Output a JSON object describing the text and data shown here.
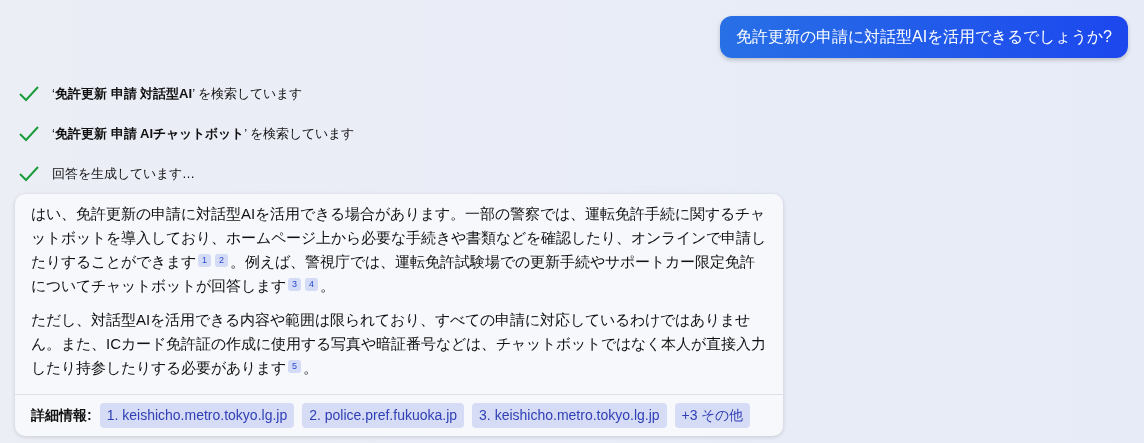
{
  "user_message": "免許更新の申請に対話型AIを活用できるでしょうか?",
  "progress": [
    {
      "text": "‘**免許更新 申請 対話型AI**’ を検索しています",
      "done": true
    },
    {
      "text": "‘**免許更新 申請 AIチャットボット**’ を検索しています",
      "done": true
    },
    {
      "text": "回答を生成しています…",
      "done": true
    }
  ],
  "answer": {
    "paragraphs": [
      [
        {
          "kind": "text",
          "text": "はい、免許更新の申請に対話型AIを活用できる場合があります。一部の警察では、運転免許手続に関するチャットボットを導入しており、ホームページ上から必要な手続きや書類などを確認したり、オンラインで申請したりすることができます"
        },
        {
          "kind": "cite",
          "text": "1"
        },
        {
          "kind": "cite",
          "text": "2"
        },
        {
          "kind": "text",
          "text": "。例えば、警視庁では、運転免許試験場での更新手続やサポートカー限定免許についてチャットボットが回答します"
        },
        {
          "kind": "cite",
          "text": "3"
        },
        {
          "kind": "cite",
          "text": "4"
        },
        {
          "kind": "text",
          "text": "。"
        }
      ],
      [
        {
          "kind": "text",
          "text": "ただし、対話型AIを活用できる内容や範囲は限られており、すべての申請に対応しているわけではありません。また、ICカード免許証の作成に使用する写真や暗証番号などは、チャットボットではなく本人が直接入力したり持参したりする必要があります"
        },
        {
          "kind": "cite",
          "text": "5"
        },
        {
          "kind": "text",
          "text": "。"
        }
      ]
    ],
    "sources_label": "詳細情報:",
    "sources": [
      "1. keishicho.metro.tokyo.lg.jp",
      "2. police.pref.fukuoka.jp",
      "3. keishicho.metro.tokyo.lg.jp",
      "+3 その他"
    ]
  }
}
